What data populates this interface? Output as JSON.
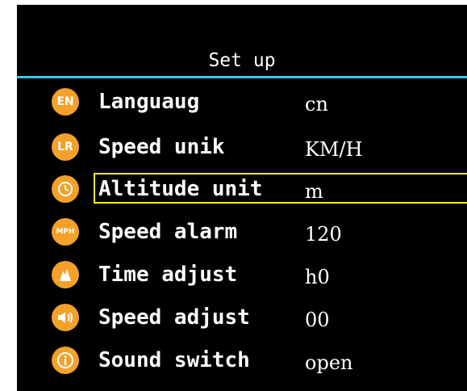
{
  "header": {
    "title": "Set up"
  },
  "menu": {
    "selected_index": 2,
    "items": [
      {
        "icon": "EN",
        "icon_name": "language-en-icon",
        "label": "Languaug",
        "value": "cn"
      },
      {
        "icon": "LR",
        "icon_name": "speed-unit-lr-icon",
        "label": "Speed unik",
        "value": "KM/H"
      },
      {
        "icon": "",
        "icon_name": "clock-icon",
        "label": "Altitude unit",
        "value": "m"
      },
      {
        "icon": "MPH",
        "icon_name": "mph-icon",
        "label": "Speed alarm",
        "value": "120"
      },
      {
        "icon": "",
        "icon_name": "mountain-icon",
        "label": "Time adjust",
        "value": "h0"
      },
      {
        "icon": "",
        "icon_name": "speaker-icon",
        "label": "Speed adjust",
        "value": "00"
      },
      {
        "icon": "",
        "icon_name": "info-icon",
        "label": "Sound switch",
        "value": "open"
      }
    ]
  },
  "colors": {
    "background": "#000000",
    "text": "#ffffff",
    "icon_fill": "#f3a12a",
    "divider": "#2ec9e6",
    "highlight": "#ffff00"
  }
}
